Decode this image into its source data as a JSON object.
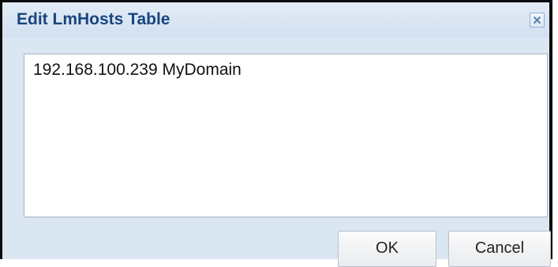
{
  "dialog": {
    "title": "Edit LmHosts Table",
    "close_icon": "close-icon",
    "textarea": {
      "value": "192.168.100.239 MyDomain"
    },
    "buttons": {
      "ok_label": "OK",
      "cancel_label": "Cancel"
    },
    "colors": {
      "title_text": "#18457f",
      "dialog_background": "#dbe6f3"
    }
  }
}
